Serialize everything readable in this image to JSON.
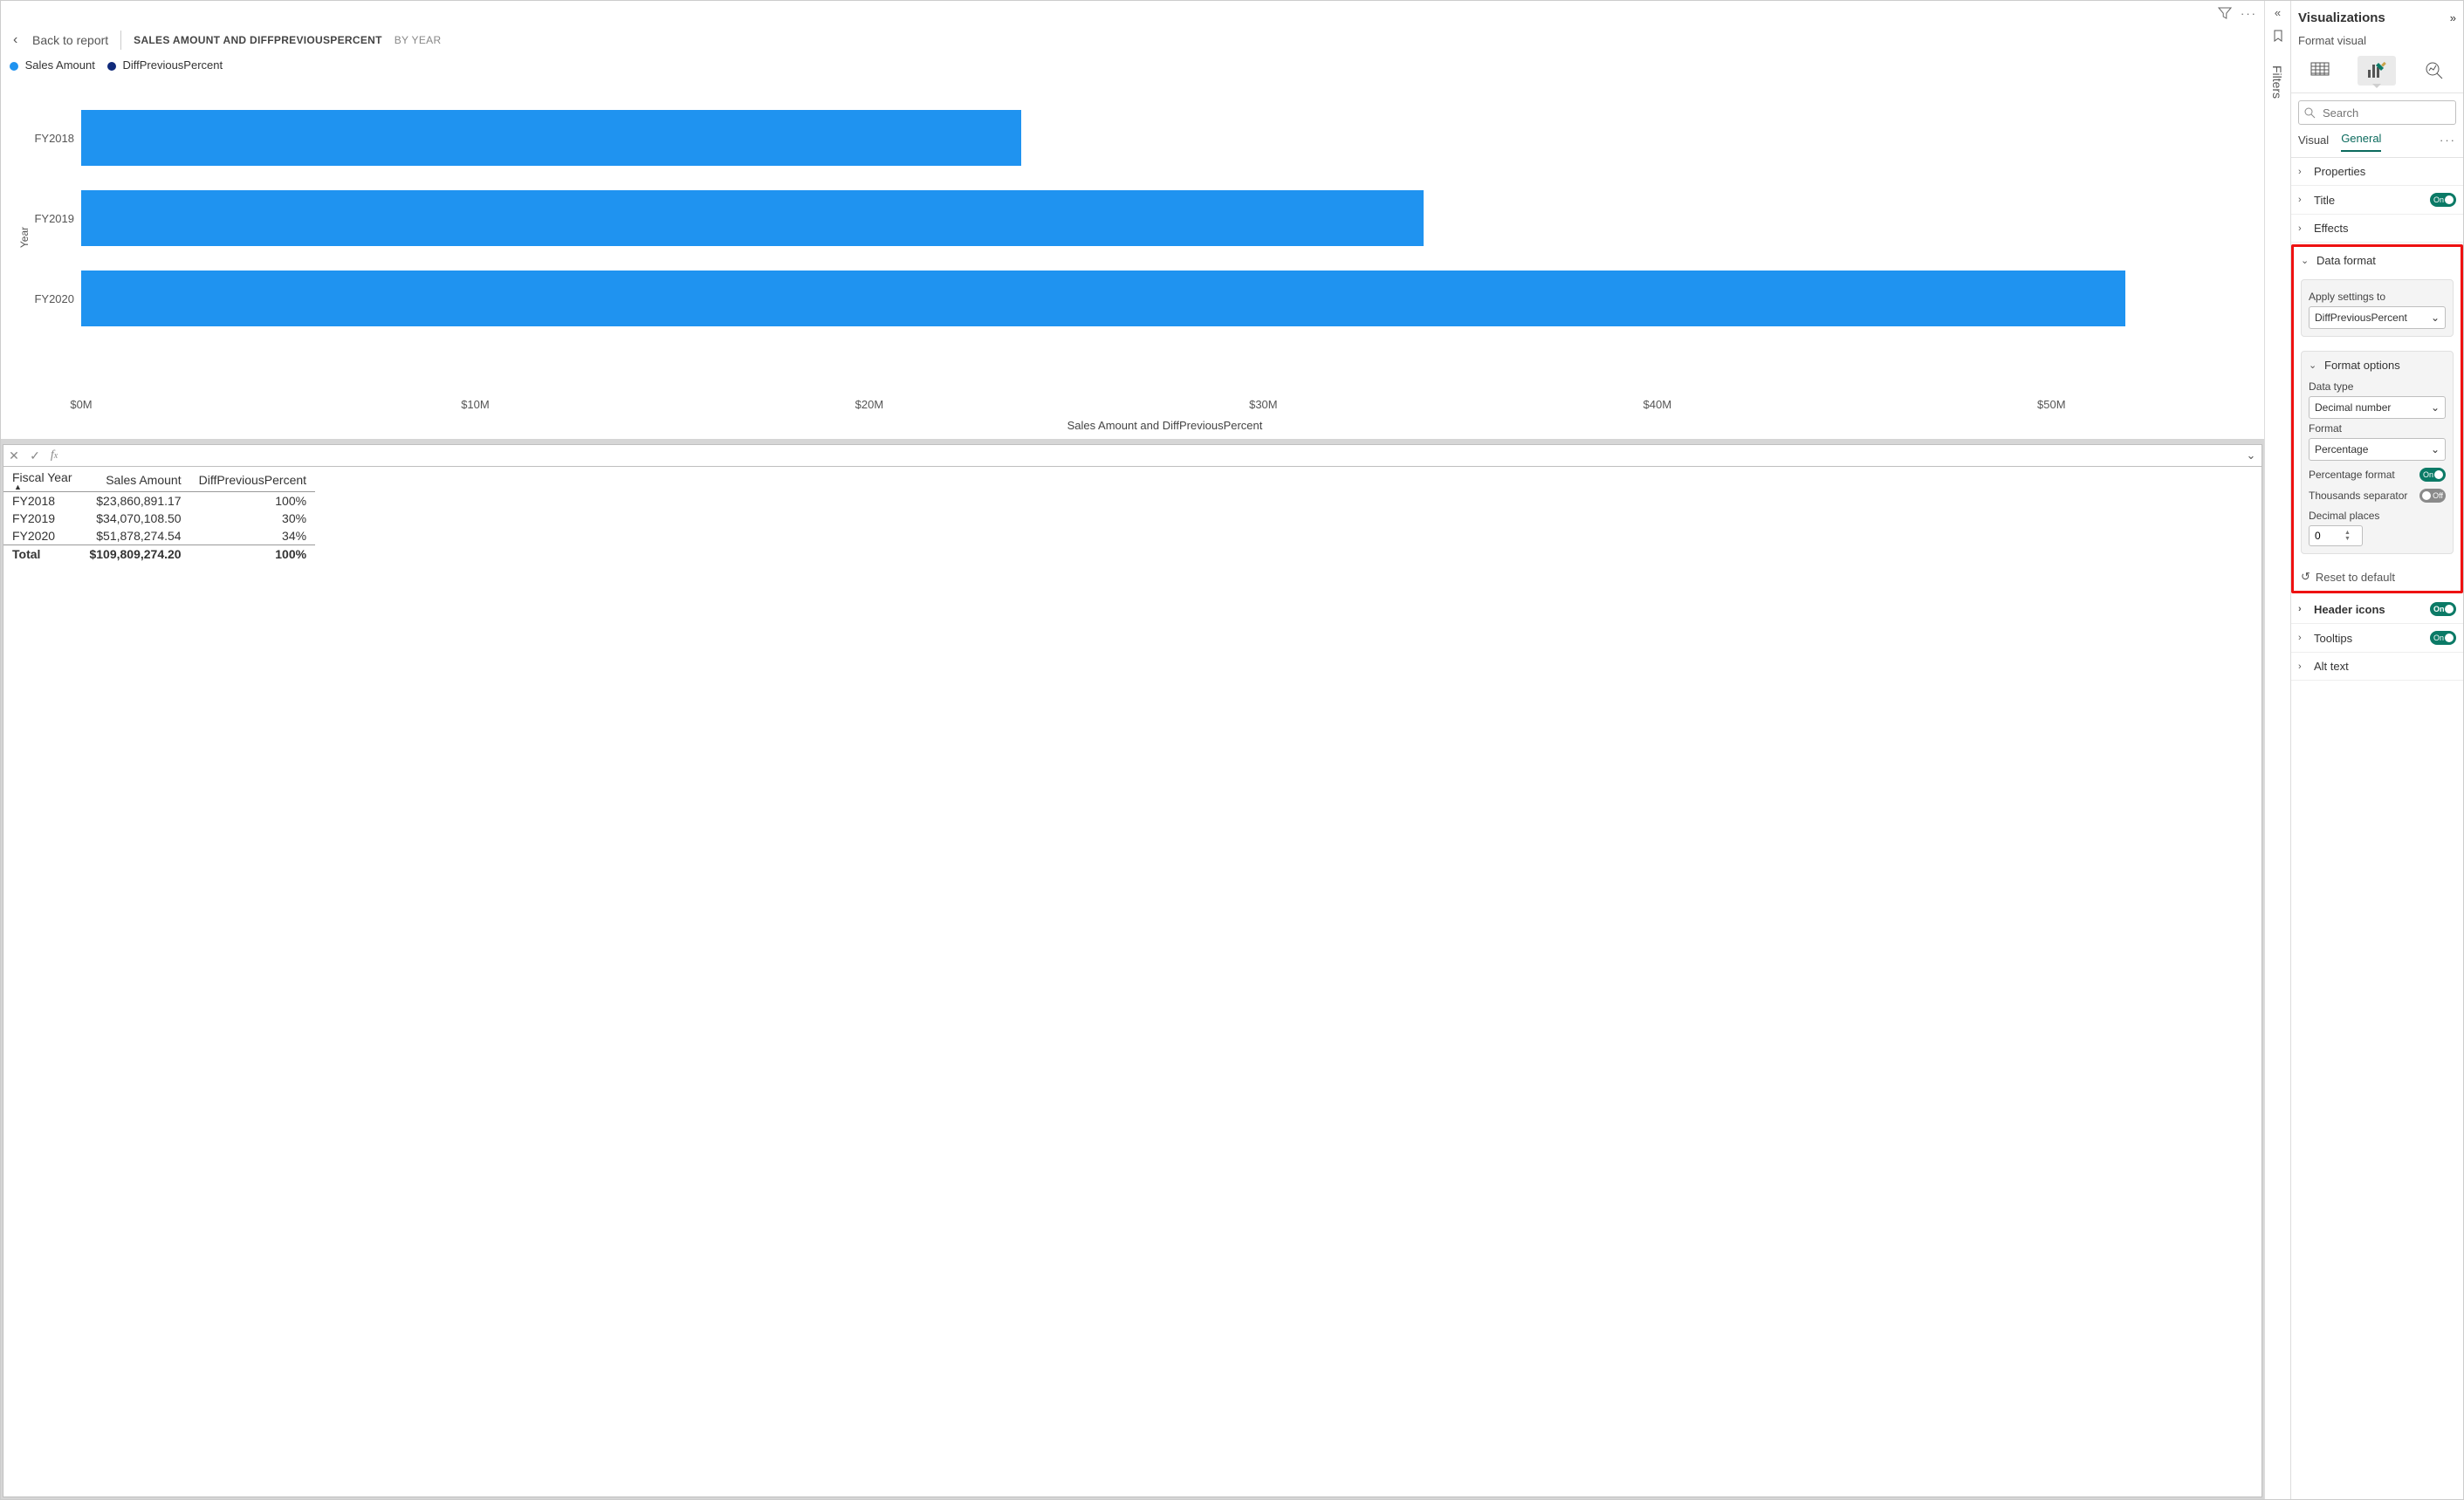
{
  "toolbar_icons": {
    "filter": "filter-icon",
    "more": "more-icon"
  },
  "header": {
    "back": "Back to report",
    "title": "SALES AMOUNT AND DIFFPREVIOUSPERCENT",
    "sub": "BY YEAR"
  },
  "legend": {
    "series1": {
      "label": "Sales Amount",
      "color": "#1f93f0"
    },
    "series2": {
      "label": "DiffPreviousPercent",
      "color": "#102a7a"
    }
  },
  "chart_data": {
    "type": "bar",
    "orientation": "horizontal",
    "categories": [
      "FY2018",
      "FY2019",
      "FY2020"
    ],
    "series": [
      {
        "name": "Sales Amount",
        "values": [
          23.86,
          34.07,
          51.88
        ]
      }
    ],
    "x_ticks": [
      "$0M",
      "$10M",
      "$20M",
      "$30M",
      "$40M",
      "$50M"
    ],
    "xlim": [
      0,
      55
    ],
    "ylabel": "Year",
    "xlabel": "Sales Amount and DiffPreviousPercent"
  },
  "table": {
    "columns": [
      "Fiscal Year",
      "Sales Amount",
      "DiffPreviousPercent"
    ],
    "sort_col": 0,
    "rows": [
      {
        "c0": "FY2018",
        "c1": "$23,860,891.17",
        "c2": "100%"
      },
      {
        "c0": "FY2019",
        "c1": "$34,070,108.50",
        "c2": "30%"
      },
      {
        "c0": "FY2020",
        "c1": "$51,878,274.54",
        "c2": "34%"
      }
    ],
    "total": {
      "c0": "Total",
      "c1": "$109,809,274.20",
      "c2": "100%"
    }
  },
  "filters_rail": {
    "label": "Filters"
  },
  "viz": {
    "title": "Visualizations",
    "subtitle": "Format visual",
    "search_placeholder": "Search",
    "tabs": {
      "visual": "Visual",
      "general": "General"
    },
    "sections": {
      "properties": "Properties",
      "title": "Title",
      "effects": "Effects",
      "data_format": "Data format",
      "header_icons": "Header icons",
      "tooltips": "Tooltips",
      "alt_text": "Alt text"
    },
    "data_format": {
      "apply_label": "Apply settings to",
      "apply_value": "DiffPreviousPercent",
      "format_options_label": "Format options",
      "data_type_label": "Data type",
      "data_type_value": "Decimal number",
      "format_label": "Format",
      "format_value": "Percentage",
      "pct_format_label": "Percentage format",
      "pct_format_on": "On",
      "thou_sep_label": "Thousands separator",
      "thou_sep_off": "Off",
      "dec_places_label": "Decimal places",
      "dec_places_value": "0",
      "reset": "Reset to default"
    },
    "toggles": {
      "title": "On",
      "header_icons": "On",
      "tooltips": "On"
    }
  }
}
